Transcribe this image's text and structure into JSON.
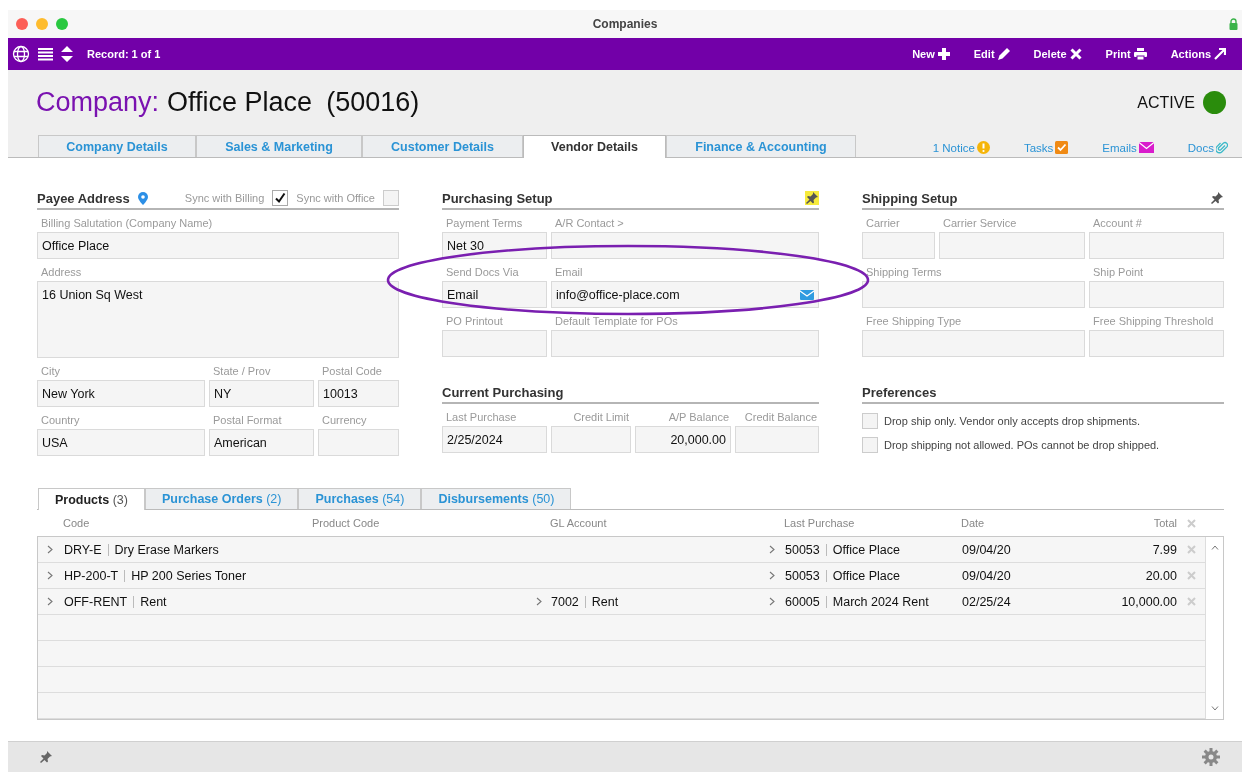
{
  "window": {
    "title": "Companies"
  },
  "toolbar": {
    "record": "Record: 1 of 1",
    "actions": [
      {
        "label": "New",
        "kind": "new"
      },
      {
        "label": "Edit",
        "kind": "edit"
      },
      {
        "label": "Delete",
        "kind": "delete"
      },
      {
        "label": "Print",
        "kind": "print"
      },
      {
        "label": "Actions",
        "kind": "actions"
      }
    ]
  },
  "header": {
    "prefix": "Company:",
    "name": "Office Place",
    "number": "(50016)",
    "status": {
      "label": "ACTIVE",
      "color": "#2a8c0c"
    }
  },
  "tabs": [
    {
      "label": "Company Details",
      "selected": false
    },
    {
      "label": "Sales & Marketing",
      "selected": false
    },
    {
      "label": "Customer Details",
      "selected": false
    },
    {
      "label": "Vendor Details",
      "selected": true
    },
    {
      "label": "Finance & Accounting",
      "selected": false
    }
  ],
  "links": [
    {
      "label": "1 Notice",
      "kind": "notice"
    },
    {
      "label": "Tasks",
      "kind": "tasks"
    },
    {
      "label": "Emails",
      "kind": "emails"
    },
    {
      "label": "Docs",
      "kind": "docs"
    }
  ],
  "payee": {
    "title": "Payee Address",
    "sync": [
      {
        "label": "Sync with Billing",
        "checked": true
      },
      {
        "label": "Sync with Office",
        "checked": false
      }
    ],
    "fields": [
      {
        "label": "Billing Salutation (Company Name)",
        "value": "Office Place",
        "kind": "text"
      },
      {
        "label": "Address",
        "value": "16 Union Sq West",
        "kind": "area"
      },
      {
        "label": "City",
        "value": "New York",
        "kind": "text"
      },
      {
        "label": "State / Prov",
        "value": "NY",
        "kind": "text"
      },
      {
        "label": "Postal Code",
        "value": "10013",
        "kind": "text"
      },
      {
        "label": "Country",
        "value": "USA",
        "kind": "text"
      },
      {
        "label": "Postal Format",
        "value": "American",
        "kind": "text"
      },
      {
        "label": "Currency",
        "kind": "text"
      }
    ]
  },
  "purchasing": {
    "title": "Purchasing Setup",
    "pinned": true,
    "fields": [
      {
        "label": "Payment Terms",
        "value": "Net 30",
        "kind": "text"
      },
      {
        "label": "A/R Contact >",
        "kind": "text"
      },
      {
        "label": "Send Docs Via",
        "value": "Email",
        "kind": "text"
      },
      {
        "label": "Email",
        "value": "info@office-place.com",
        "kind": "email"
      },
      {
        "label": "PO Printout",
        "kind": "text"
      },
      {
        "label": "Default Template for POs",
        "kind": "text"
      }
    ]
  },
  "current_purchasing": {
    "title": "Current Purchasing",
    "fields": [
      {
        "label": "Last Purchase",
        "value": "2/25/2024",
        "kind": "text"
      },
      {
        "label": "Credit Limit",
        "kind": "amount"
      },
      {
        "label": "A/P Balance",
        "value": "20,000.00",
        "kind": "amount"
      },
      {
        "label": "Credit Balance",
        "kind": "amount"
      }
    ]
  },
  "shipping": {
    "title": "Shipping Setup",
    "pinned": false,
    "fields": [
      {
        "label": "Carrier",
        "kind": "text"
      },
      {
        "label": "Carrier Service",
        "kind": "text"
      },
      {
        "label": "Account #",
        "kind": "text"
      },
      {
        "label": "Shipping Terms",
        "kind": "text"
      },
      {
        "label": "Ship Point",
        "kind": "text"
      },
      {
        "label": "Free Shipping Type",
        "kind": "text"
      },
      {
        "label": "Free Shipping Threshold",
        "kind": "text"
      }
    ]
  },
  "preferences": {
    "title": "Preferences",
    "options": [
      {
        "label": "Drop ship only. Vendor only accepts drop shipments.",
        "checked": false
      },
      {
        "label": "Drop shipping not allowed. POs cannot be drop shipped.",
        "checked": false
      }
    ]
  },
  "annotation": {
    "kind": "ellipse"
  },
  "bottom_tabs": [
    {
      "label": "Products",
      "count": "(3)",
      "selected": true
    },
    {
      "label": "Purchase Orders",
      "count": "(2)",
      "selected": false
    },
    {
      "label": "Purchases",
      "count": "(54)",
      "selected": false
    },
    {
      "label": "Disbursements",
      "count": "(50)",
      "selected": false
    }
  ],
  "table": {
    "columns": [
      "Code",
      "Product Code",
      "GL Account",
      "Last Purchase",
      "Date",
      "Total"
    ],
    "rows": [
      {
        "item": {
          "code": "DRY-E",
          "name": "Dry Erase Markers"
        },
        "last_purchase": {
          "code": "50053",
          "name": "Office Place"
        },
        "date": "09/04/20",
        "total": "7.99"
      },
      {
        "item": {
          "code": "HP-200-T",
          "name": "HP 200 Series Toner"
        },
        "last_purchase": {
          "code": "50053",
          "name": "Office Place"
        },
        "date": "09/04/20",
        "total": "20.00"
      },
      {
        "item": {
          "code": "OFF-RENT",
          "name": "Rent"
        },
        "gl_account": {
          "code": "7002",
          "name": "Rent"
        },
        "last_purchase": {
          "code": "60005",
          "name": "March 2024 Rent"
        },
        "date": "02/25/24",
        "total": "10,000.00"
      }
    ]
  }
}
